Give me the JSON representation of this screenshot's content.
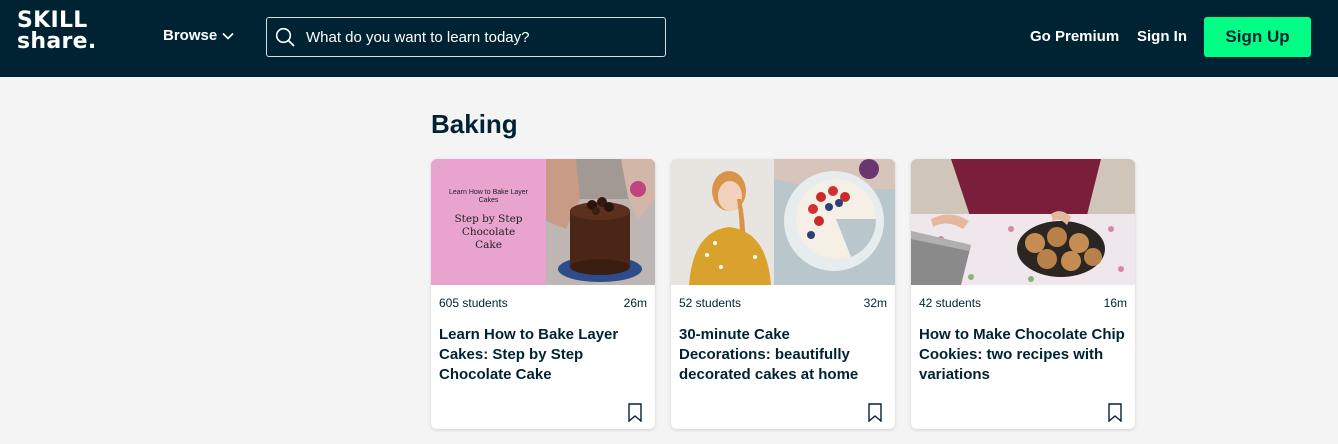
{
  "header": {
    "logo_line1": "SKILL",
    "logo_line2": "share.",
    "browse_label": "Browse",
    "search_placeholder": "What do you want to learn today?",
    "go_premium": "Go Premium",
    "sign_in": "Sign In",
    "sign_up": "Sign Up"
  },
  "section": {
    "title": "Baking"
  },
  "cards": [
    {
      "thumb_text_small": "Learn How to Bake Layer Cakes",
      "thumb_text_large": "Step by Step Chocolate Cake",
      "students": "605 students",
      "duration": "26m",
      "title": "Learn How to Bake Layer Cakes: Step by Step Chocolate Cake"
    },
    {
      "students": "52 students",
      "duration": "32m",
      "title": "30-minute Cake Decorations: beautifully decorated cakes at home"
    },
    {
      "students": "42 students",
      "duration": "16m",
      "title": "How to Make Chocolate Chip Cookies: two recipes with variations"
    }
  ],
  "colors": {
    "header_bg": "#002333",
    "accent": "#00ff84",
    "page_bg": "#f4f4f4"
  }
}
